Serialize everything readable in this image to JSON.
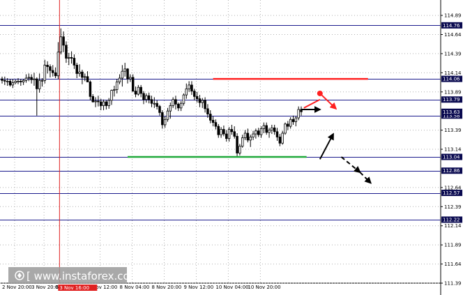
{
  "chart_data": {
    "type": "candlestick",
    "ylim": [
      111.39,
      115.0
    ],
    "y_ticks": [
      "114.89",
      "114.64",
      "114.39",
      "114.14",
      "113.89",
      "113.39",
      "113.14",
      "112.64",
      "112.39",
      "112.14",
      "111.89",
      "111.64",
      "111.39"
    ],
    "x_ticks": [
      {
        "label": "2 Nov 20:00",
        "slot": 0
      },
      {
        "label": "3 Nov 20:00",
        "slot": 11
      },
      {
        "label": "6 Nov 20:00",
        "slot": 20
      },
      {
        "label": "7 Nov 12:00",
        "slot": 32
      },
      {
        "label": "8 Nov 04:00",
        "slot": 44
      },
      {
        "label": "8 Nov 20:00",
        "slot": 56
      },
      {
        "label": "9 Nov 12:00",
        "slot": 68
      },
      {
        "label": "10 Nov 04:00",
        "slot": 80
      },
      {
        "label": "10 Nov 20:00",
        "slot": 92
      }
    ],
    "x_slots": 165,
    "levels": [
      {
        "value": 114.76,
        "label": "114.76"
      },
      {
        "value": 114.06,
        "label": "114.06"
      },
      {
        "value": 113.79,
        "label": "113.79"
      },
      {
        "value": 113.58,
        "label": "113.58"
      },
      {
        "value": 113.04,
        "label": "113.04"
      },
      {
        "value": 112.86,
        "label": "112.86"
      },
      {
        "value": 112.57,
        "label": "112.57"
      },
      {
        "value": 112.22,
        "label": "112.22"
      }
    ],
    "current_price": {
      "value": 113.63,
      "label": "113.63"
    },
    "resistance_line": {
      "value": 114.06,
      "from_slot": 79,
      "to_slot": 137,
      "color": "#ff2020"
    },
    "support_line": {
      "value": 113.04,
      "from_slot": 47,
      "to_slot": 114,
      "color": "#1fa83a"
    },
    "vertical_marker": {
      "slot": 21.5,
      "color": "#e02020",
      "label": "3 Nov 16:00"
    },
    "colors": {
      "grid": "#b0b0b0",
      "level": "#1a1a8c",
      "candle": "#000000",
      "price_tag_bg": "#0a0a50"
    },
    "series": [
      {
        "values": [
          [
            114.06,
            114.09,
            114.0,
            114.04
          ],
          [
            114.04,
            114.09,
            113.98,
            114.03
          ],
          [
            114.03,
            114.07,
            113.97,
            114.03
          ],
          [
            114.03,
            114.06,
            113.96,
            113.98
          ],
          [
            113.98,
            114.06,
            113.94,
            114.01
          ],
          [
            114.01,
            114.05,
            113.99,
            114.03
          ],
          [
            114.03,
            114.07,
            113.99,
            114.03
          ],
          [
            114.03,
            114.06,
            113.97,
            114.02
          ],
          [
            114.02,
            114.06,
            113.98,
            114.04
          ],
          [
            114.04,
            114.12,
            114.01,
            114.07
          ],
          [
            114.07,
            114.13,
            114.03,
            114.08
          ],
          [
            114.08,
            114.12,
            114.0,
            114.05
          ],
          [
            114.05,
            114.14,
            113.97,
            114.06
          ],
          [
            114.06,
            114.08,
            113.58,
            113.93
          ],
          [
            113.93,
            114.13,
            113.88,
            114.04
          ],
          [
            114.04,
            114.07,
            113.96,
            114.04
          ],
          [
            114.04,
            114.31,
            114.0,
            114.24
          ],
          [
            114.24,
            114.29,
            114.13,
            114.22
          ],
          [
            114.22,
            114.25,
            114.08,
            114.17
          ],
          [
            114.17,
            114.24,
            114.09,
            114.14
          ],
          [
            114.14,
            114.21,
            114.07,
            114.1
          ],
          [
            114.1,
            114.54,
            114.06,
            114.41
          ],
          [
            114.41,
            114.72,
            114.38,
            114.61
          ],
          [
            114.61,
            114.68,
            114.41,
            114.5
          ],
          [
            114.5,
            114.55,
            114.27,
            114.33
          ],
          [
            114.33,
            114.4,
            114.24,
            114.34
          ],
          [
            114.34,
            114.42,
            114.26,
            114.33
          ],
          [
            114.33,
            114.38,
            114.19,
            114.24
          ],
          [
            114.24,
            114.27,
            114.07,
            114.13
          ],
          [
            114.13,
            114.25,
            114.09,
            114.15
          ],
          [
            114.15,
            114.18,
            113.99,
            114.08
          ],
          [
            114.08,
            114.13,
            114.03,
            114.09
          ],
          [
            114.09,
            114.16,
            114.02,
            114.02
          ],
          [
            114.02,
            114.04,
            113.78,
            113.83
          ],
          [
            113.83,
            113.86,
            113.75,
            113.76
          ],
          [
            113.76,
            113.82,
            113.69,
            113.77
          ],
          [
            113.77,
            113.84,
            113.7,
            113.76
          ],
          [
            113.76,
            113.8,
            113.65,
            113.71
          ],
          [
            113.71,
            113.79,
            113.65,
            113.76
          ],
          [
            113.76,
            113.78,
            113.66,
            113.71
          ],
          [
            113.71,
            113.81,
            113.67,
            113.78
          ],
          [
            113.78,
            113.92,
            113.72,
            113.91
          ],
          [
            113.91,
            113.97,
            113.83,
            113.92
          ],
          [
            113.92,
            114.06,
            113.87,
            114.02
          ],
          [
            114.02,
            114.12,
            113.99,
            114.07
          ],
          [
            114.07,
            114.24,
            113.96,
            114.16
          ],
          [
            114.16,
            114.27,
            114.09,
            114.19
          ],
          [
            114.19,
            114.2,
            114.0,
            114.06
          ],
          [
            114.06,
            114.12,
            114.02,
            114.08
          ],
          [
            114.08,
            114.12,
            113.89,
            113.9
          ],
          [
            113.9,
            113.96,
            113.82,
            113.86
          ],
          [
            113.86,
            113.98,
            113.84,
            113.95
          ],
          [
            113.95,
            113.98,
            113.82,
            113.87
          ],
          [
            113.87,
            113.9,
            113.73,
            113.79
          ],
          [
            113.79,
            113.87,
            113.75,
            113.84
          ],
          [
            113.84,
            113.88,
            113.74,
            113.79
          ],
          [
            113.79,
            113.84,
            113.69,
            113.74
          ],
          [
            113.74,
            113.82,
            113.68,
            113.74
          ],
          [
            113.74,
            113.78,
            113.66,
            113.7
          ],
          [
            113.7,
            113.72,
            113.58,
            113.62
          ],
          [
            113.62,
            113.65,
            113.41,
            113.46
          ],
          [
            113.46,
            113.57,
            113.42,
            113.53
          ],
          [
            113.53,
            113.68,
            113.5,
            113.64
          ],
          [
            113.64,
            113.75,
            113.54,
            113.71
          ],
          [
            113.71,
            113.82,
            113.68,
            113.79
          ],
          [
            113.79,
            113.84,
            113.66,
            113.73
          ],
          [
            113.73,
            113.75,
            113.64,
            113.68
          ],
          [
            113.68,
            113.77,
            113.64,
            113.74
          ],
          [
            113.74,
            113.87,
            113.71,
            113.85
          ],
          [
            113.85,
            114.0,
            113.8,
            113.93
          ],
          [
            113.93,
            114.03,
            113.89,
            113.98
          ],
          [
            113.98,
            114.03,
            113.85,
            113.9
          ],
          [
            113.9,
            113.93,
            113.78,
            113.83
          ],
          [
            113.83,
            113.89,
            113.75,
            113.8
          ],
          [
            113.8,
            113.85,
            113.69,
            113.75
          ],
          [
            113.75,
            113.81,
            113.68,
            113.78
          ],
          [
            113.78,
            113.82,
            113.62,
            113.67
          ],
          [
            113.67,
            113.73,
            113.55,
            113.6
          ],
          [
            113.6,
            113.65,
            113.48,
            113.52
          ],
          [
            113.52,
            113.57,
            113.44,
            113.49
          ],
          [
            113.49,
            113.53,
            113.4,
            113.44
          ],
          [
            113.44,
            113.47,
            113.29,
            113.33
          ],
          [
            113.33,
            113.43,
            113.29,
            113.4
          ],
          [
            113.4,
            113.45,
            113.31,
            113.34
          ],
          [
            113.34,
            113.39,
            113.24,
            113.28
          ],
          [
            113.28,
            113.43,
            113.24,
            113.4
          ],
          [
            113.4,
            113.46,
            113.33,
            113.37
          ],
          [
            113.37,
            113.44,
            113.28,
            113.31
          ],
          [
            113.31,
            113.35,
            113.05,
            113.09
          ],
          [
            113.09,
            113.21,
            113.06,
            113.18
          ],
          [
            113.18,
            113.33,
            113.16,
            113.29
          ],
          [
            113.29,
            113.39,
            113.26,
            113.35
          ],
          [
            113.35,
            113.41,
            113.23,
            113.26
          ],
          [
            113.26,
            113.33,
            113.17,
            113.3
          ],
          [
            113.3,
            113.38,
            113.26,
            113.34
          ],
          [
            113.34,
            113.41,
            113.28,
            113.38
          ],
          [
            113.38,
            113.42,
            113.3,
            113.33
          ],
          [
            113.33,
            113.44,
            113.29,
            113.41
          ],
          [
            113.41,
            113.49,
            113.35,
            113.45
          ],
          [
            113.45,
            113.49,
            113.33,
            113.36
          ],
          [
            113.36,
            113.42,
            113.29,
            113.39
          ],
          [
            113.39,
            113.46,
            113.34,
            113.42
          ],
          [
            113.42,
            113.46,
            113.33,
            113.37
          ],
          [
            113.37,
            113.42,
            113.25,
            113.3
          ],
          [
            113.3,
            113.34,
            113.18,
            113.22
          ],
          [
            113.22,
            113.38,
            113.2,
            113.35
          ],
          [
            113.35,
            113.49,
            113.33,
            113.47
          ],
          [
            113.47,
            113.51,
            113.39,
            113.44
          ],
          [
            113.44,
            113.56,
            113.41,
            113.53
          ],
          [
            113.53,
            113.58,
            113.46,
            113.5
          ],
          [
            113.5,
            113.57,
            113.44,
            113.55
          ],
          [
            113.55,
            113.7,
            113.52,
            113.66
          ],
          [
            113.66,
            113.7,
            113.58,
            113.63
          ]
        ]
      }
    ],
    "forecast_arrows": [
      {
        "color": "#000000",
        "dashed": false,
        "from": [
          113.66,
          113.63
        ],
        "to": [
          113.66,
          113.01
        ],
        "from_slot": 112,
        "to_slot": 119
      },
      {
        "color": "#000000",
        "dashed": false,
        "from": [
          113.01,
          113.01
        ],
        "to": [
          113.34,
          113.34
        ],
        "from_slot": 119,
        "to_slot": 124
      },
      {
        "color": "#000000",
        "dashed": true,
        "from": [
          113.04,
          113.04
        ],
        "to": [
          112.84,
          112.84
        ],
        "from_slot": 127,
        "to_slot": 134
      },
      {
        "color": "#000000",
        "dashed": true,
        "from": [
          112.84,
          112.84
        ],
        "to": [
          112.7,
          112.7
        ],
        "from_slot": 134,
        "to_slot": 138
      },
      {
        "color": "#ff2020",
        "dashed": false,
        "from": [
          113.68,
          113.68
        ],
        "to": [
          113.79,
          113.79
        ],
        "from_slot": 113,
        "to_slot": 119,
        "head": false
      },
      {
        "color": "#ff2020",
        "dashed": false,
        "from": [
          113.87,
          113.87
        ],
        "to": [
          113.67,
          113.67
        ],
        "from_slot": 119,
        "to_slot": 125,
        "dot_at_start": true
      }
    ]
  },
  "watermark": {
    "text": "[   www.instaforex.com   ]",
    "icon": "instaforex-logo-icon"
  },
  "xaxis_highlight_label": "3 Nov 16:00"
}
